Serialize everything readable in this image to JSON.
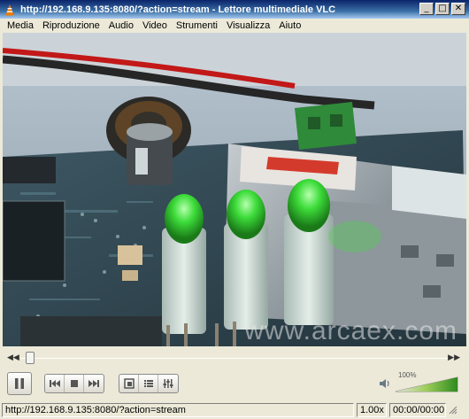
{
  "window": {
    "title": "http://192.168.9.135:8080/?action=stream - Lettore multimediale VLC",
    "minimize": "_",
    "maximize": "□",
    "close": "✕"
  },
  "menu": {
    "items": [
      "Media",
      "Riproduzione",
      "Audio",
      "Video",
      "Strumenti",
      "Visualizza",
      "Aiuto"
    ]
  },
  "video": {
    "watermark": "www.arcaex.com"
  },
  "seek": {
    "position_fraction": 0.01
  },
  "controls": {
    "icons": [
      "pause-icon",
      "previous-icon",
      "stop-icon",
      "next-icon",
      "fullscreen-icon",
      "playlist-icon",
      "extended-settings-icon"
    ]
  },
  "volume": {
    "label": "100%",
    "level_percent": 100,
    "icon": "speaker-icon"
  },
  "status": {
    "url": "http://192.168.9.135:8080/?action=stream",
    "speed": "1.00x",
    "time": "00:00/00:00"
  },
  "colors": {
    "title_gradient_start": "#0a246a",
    "title_gradient_end": "#a6caf0",
    "led_green": "#3ddc3a"
  }
}
